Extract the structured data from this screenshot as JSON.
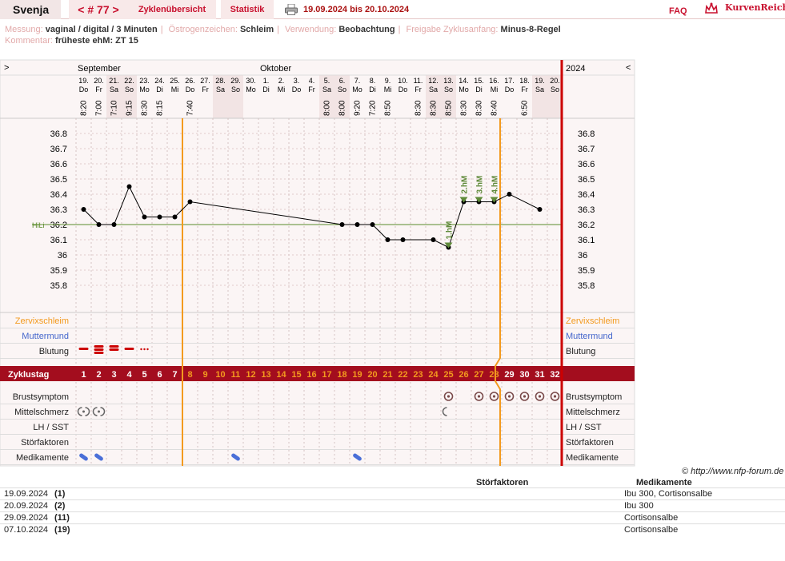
{
  "header": {
    "user": "Svenja",
    "cycle": "< # 77 >",
    "tab_overview": "Zyklenübersicht",
    "tab_stats": "Statistik",
    "period": "19.09.2024 bis 20.10.2024",
    "faq": "FAQ",
    "brand": "KurvenReich",
    "print_icon": "printer-icon",
    "logo_icon": "crown-icon"
  },
  "meta": {
    "messung_label": "Messung:",
    "messung": "vaginal / digital / 3 Minuten",
    "oestrogen_label": "Östrogenzeichen:",
    "oestrogen": "Schleim",
    "verwendung_label": "Verwendung:",
    "verwendung": "Beobachtung",
    "freigabe_label": "Freigabe Zyklusanfang:",
    "freigabe": "Minus-8-Regel",
    "kommentar_label": "Kommentar:",
    "kommentar": "früheste ehM: ZT 15"
  },
  "chart_data": {
    "type": "line",
    "nav_left": ">",
    "nav_right": "<",
    "year": "2024",
    "months": [
      {
        "label": "September",
        "at_day": 1
      },
      {
        "label": "Oktober",
        "at_day": 13
      }
    ],
    "dates": [
      "19.",
      "20.",
      "21.",
      "22.",
      "23.",
      "24.",
      "25.",
      "26.",
      "27.",
      "28.",
      "29.",
      "30.",
      "1.",
      "2.",
      "3.",
      "4.",
      "5.",
      "6.",
      "7.",
      "8.",
      "9.",
      "10.",
      "11.",
      "12.",
      "13.",
      "14.",
      "15.",
      "16.",
      "17.",
      "18.",
      "19.",
      "20."
    ],
    "weekdays": [
      "Do",
      "Fr",
      "Sa",
      "So",
      "Mo",
      "Di",
      "Mi",
      "Do",
      "Fr",
      "Sa",
      "So",
      "Mo",
      "Di",
      "Mi",
      "Do",
      "Fr",
      "Sa",
      "So",
      "Mo",
      "Di",
      "Mi",
      "Do",
      "Fr",
      "Sa",
      "So",
      "Mo",
      "Di",
      "Mi",
      "Do",
      "Fr",
      "Sa",
      "So"
    ],
    "weekend_days": [
      3,
      4,
      10,
      11,
      17,
      18,
      24,
      25,
      31,
      32
    ],
    "times": [
      "8:20",
      "7:00",
      "7:10",
      "9:15",
      "8:30",
      "8:15",
      "",
      "7:40",
      "",
      "",
      "",
      "",
      "",
      "",
      "",
      "",
      "8:00",
      "8:00",
      "9:20",
      "7:20",
      "8:50",
      "",
      "8:30",
      "8:30",
      "8:50",
      "8:30",
      "8:30",
      "8:40",
      "",
      "6:50",
      "",
      ""
    ],
    "temps": [
      36.3,
      36.2,
      36.2,
      36.45,
      36.25,
      36.25,
      36.25,
      36.35,
      null,
      null,
      null,
      null,
      null,
      null,
      null,
      null,
      null,
      36.2,
      36.2,
      36.2,
      36.1,
      36.1,
      null,
      36.1,
      36.05,
      36.35,
      36.35,
      36.35,
      36.4,
      null,
      36.3,
      null
    ],
    "ylim": [
      35.8,
      36.8
    ],
    "yticks": [
      "36.8",
      "36.7",
      "36.6",
      "36.5",
      "36.4",
      "36.3",
      "36.2",
      "36.1",
      "36",
      "35.9",
      "35.8"
    ],
    "hili": {
      "label": "HiLi",
      "value": 36.2
    },
    "hm_labels": [
      {
        "day": 25,
        "text": "1.hM"
      },
      {
        "day": 26,
        "text": "2.hM"
      },
      {
        "day": 27,
        "text": "3.hM"
      },
      {
        "day": 28,
        "text": "4.hM"
      }
    ],
    "cycle_start_marker_day": 8,
    "ovulation_marker_day": 28,
    "rows": {
      "zervix": "Zervixschleim",
      "muttermund": "Muttermund",
      "blutung": "Blutung",
      "zyklustag": "Zyklustag",
      "brust": "Brustsymptom",
      "mittel": "Mittelschmerz",
      "lh": "LH / SST",
      "stoer": "Störfaktoren",
      "medi": "Medikamente"
    },
    "bleeding": [
      {
        "day": 1,
        "level": 1
      },
      {
        "day": 2,
        "level": 3
      },
      {
        "day": 3,
        "level": 2
      },
      {
        "day": 4,
        "level": 1
      },
      {
        "day": 5,
        "level": 0
      }
    ],
    "cycle_days": [
      "1",
      "2",
      "3",
      "4",
      "5",
      "6",
      "7",
      "8",
      "9",
      "10",
      "11",
      "12",
      "13",
      "14",
      "15",
      "16",
      "17",
      "18",
      "19",
      "20",
      "21",
      "22",
      "23",
      "24",
      "25",
      "26",
      "27",
      "28",
      "29",
      "30",
      "31",
      "32"
    ],
    "breast_days": [
      25,
      27,
      28,
      29,
      30,
      31,
      32
    ],
    "mittelschmerz_days": [
      1,
      2,
      25
    ],
    "medication_days": [
      1,
      2,
      11,
      19
    ],
    "colors": {
      "accent": "#cc0000",
      "orange": "#f39a1e",
      "hili": "#5a8a2a",
      "hm": "#5f8a3a",
      "band": "#a30d1e",
      "weekend": "#f2e4e4",
      "panel": "#fbf5f5"
    }
  },
  "copyright": "© http://www.nfp-forum.de",
  "notes": {
    "col_stoer": "Störfaktoren",
    "col_medi": "Medikamente",
    "rows": [
      {
        "date": "19.09.2024",
        "cycle": "(1)",
        "medi": "Ibu 300, Cortisonsalbe"
      },
      {
        "date": "20.09.2024",
        "cycle": "(2)",
        "medi": "Ibu 300"
      },
      {
        "date": "29.09.2024",
        "cycle": "(11)",
        "medi": "Cortisonsalbe"
      },
      {
        "date": "07.10.2024",
        "cycle": "(19)",
        "medi": "Cortisonsalbe"
      }
    ]
  }
}
